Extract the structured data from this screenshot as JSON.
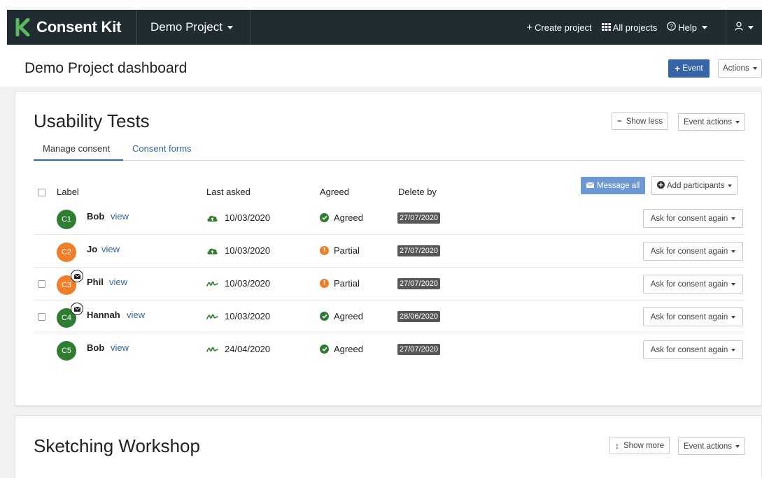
{
  "nav": {
    "brand": "Consent Kit",
    "project": "Demo Project",
    "create_project": "Create project",
    "all_projects": "All projects",
    "help": "Help"
  },
  "page": {
    "title": "Demo Project dashboard",
    "event_button": "Event",
    "actions_button": "Actions"
  },
  "events": [
    {
      "title": "Usability Tests",
      "show_toggle": "Show less",
      "event_actions": "Event actions",
      "tabs": [
        "Manage consent",
        "Consent forms"
      ],
      "table": {
        "columns": [
          "Label",
          "Last asked",
          "Agreed",
          "Delete by"
        ],
        "message_all": "Message all",
        "add_participants": "Add participants",
        "rows": [
          {
            "initials": "C1",
            "name": "Bob",
            "view": "view",
            "last_asked": "10/03/2020",
            "agreed": "Agreed",
            "delete_by": "27/07/2020",
            "action": "Ask for consent again"
          },
          {
            "initials": "C2",
            "name": "Jo",
            "view": "view",
            "last_asked": "10/03/2020",
            "agreed": "Partial",
            "delete_by": "27/07/2020",
            "action": "Ask for consent again"
          },
          {
            "initials": "C3",
            "name": "Phil",
            "view": "view",
            "last_asked": "10/03/2020",
            "agreed": "Partial",
            "delete_by": "27/07/2020",
            "action": "Ask for consent again"
          },
          {
            "initials": "C4",
            "name": "Hannah",
            "view": "view",
            "last_asked": "10/03/2020",
            "agreed": "Agreed",
            "delete_by": "28/06/2020",
            "action": "Ask for consent again"
          },
          {
            "initials": "C5",
            "name": "Bob",
            "view": "view",
            "last_asked": "24/04/2020",
            "agreed": "Agreed",
            "delete_by": "27/07/2020",
            "action": "Ask for consent again"
          }
        ]
      }
    },
    {
      "title": "Sketching Workshop",
      "show_toggle": "Show more",
      "event_actions": "Event actions"
    }
  ],
  "colors": {
    "navbar": "#1f2d33",
    "brand_green": "#5cb85c",
    "primary": "#3564a8",
    "agreed": "#2e7d32",
    "partial": "#f07e29",
    "badge": "#575757"
  },
  "icons": {
    "brand": "consent-kit-logo-icon",
    "create_project": "plus-icon",
    "all_projects": "grid-icon",
    "help": "question-circle-icon",
    "user": "user-icon",
    "message": "envelope-icon",
    "add": "plus-circle-icon",
    "asked_uploaded": "cloud-upload-icon",
    "asked_signed": "signature-icon",
    "agreed": "check-circle-icon",
    "partial": "exclamation-circle-icon"
  }
}
